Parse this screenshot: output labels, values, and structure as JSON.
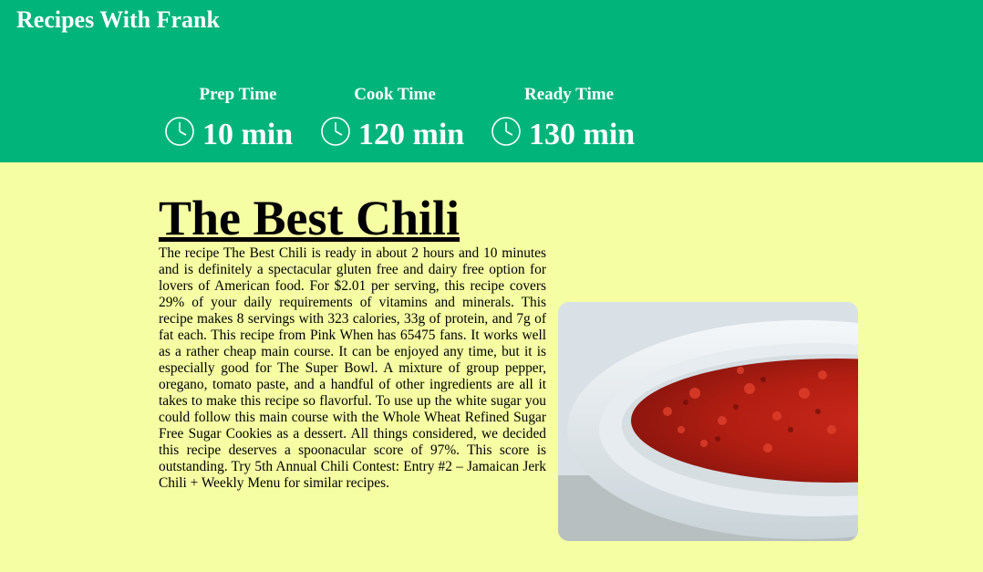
{
  "site": {
    "title": "Recipes With Frank"
  },
  "stats": [
    {
      "label": "Prep Time",
      "value": "10 min",
      "icon": "clock-icon"
    },
    {
      "label": "Cook Time",
      "value": "120 min",
      "icon": "clock-icon"
    },
    {
      "label": "Ready Time",
      "value": "130 min",
      "icon": "clock-icon"
    }
  ],
  "recipe": {
    "title": "The Best Chili",
    "summary": "The recipe The Best Chili is ready in about 2 hours and 10 minutes and is definitely a spectacular gluten free and dairy free option for lovers of American food. For $2.01 per serving, this recipe covers 29% of your daily requirements of vitamins and minerals. This recipe makes 8 servings with 323 calories, 33g of protein, and 7g of fat each. This recipe from Pink When has 65475 fans. It works well as a rather cheap main course. It can be enjoyed any time, but it is especially good for The Super Bowl. A mixture of group pepper, oregano, tomato paste, and a handful of other ingredients are all it takes to make this recipe so flavorful. To use up the white sugar you could follow this main course with the Whole Wheat Refined Sugar Free Sugar Cookies as a dessert. All things considered, we decided this recipe deserves a spoonacular score of 97%. This score is outstanding. Try 5th Annual Chili Contest: Entry #2 – Jamaican Jerk Chili + Weekly Menu for similar recipes."
  },
  "colors": {
    "header_bg": "#00b47a",
    "page_bg": "#f5fea3",
    "header_text": "#ffffff"
  }
}
